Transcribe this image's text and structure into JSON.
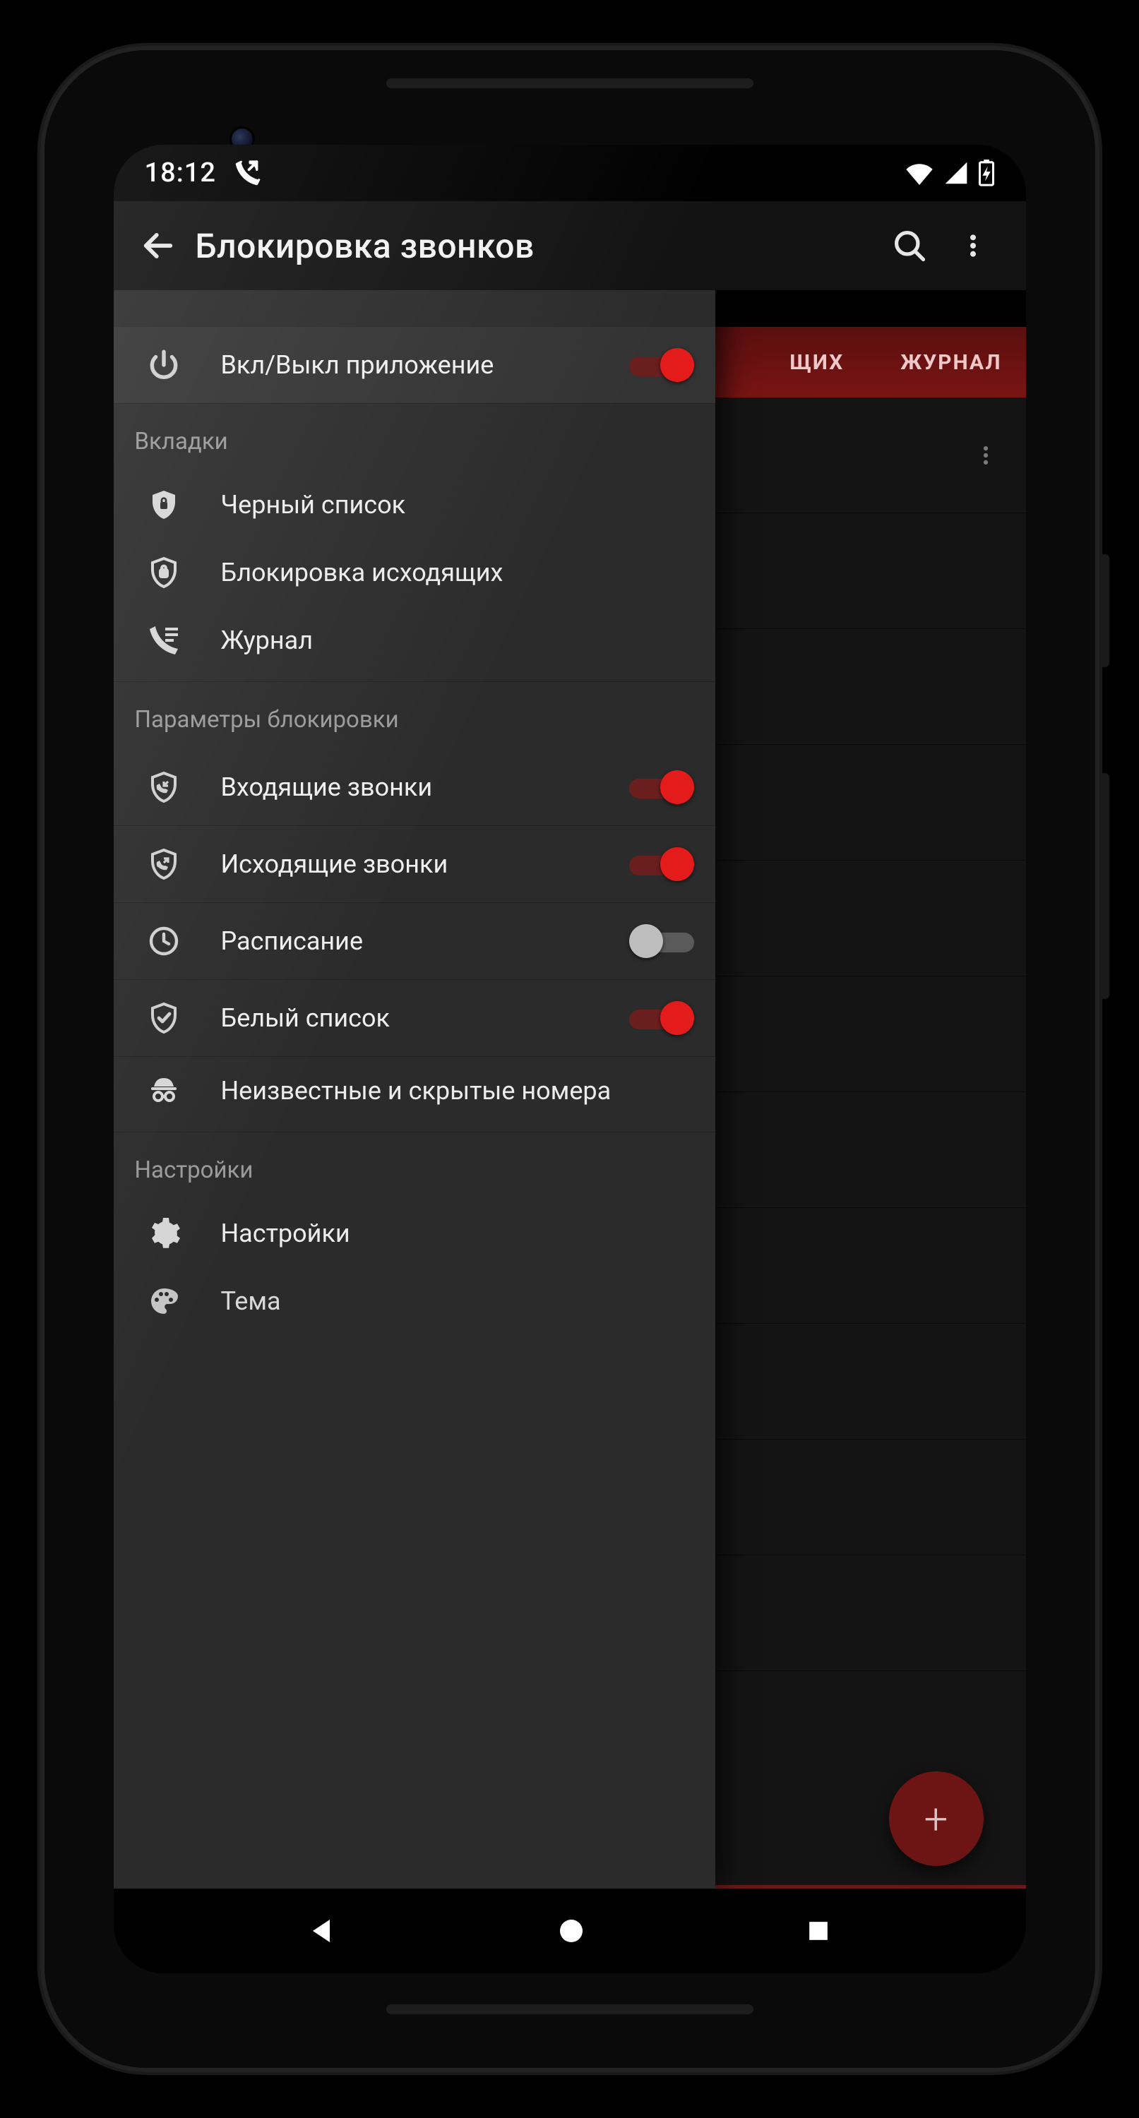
{
  "status": {
    "time": "18:12"
  },
  "appbar": {
    "title": "Блокировка звонков"
  },
  "tabs": {
    "t1_suffix": "ЩИХ",
    "t2": "ЖУРНАЛ"
  },
  "drawer": {
    "app_toggle_label": "Вкл/Выкл приложение",
    "section_tabs": "Вкладки",
    "tabs_items": {
      "blacklist": "Черный список",
      "outgoing_block": "Блокировка исходящих",
      "journal": "Журнал"
    },
    "section_params": "Параметры блокировки",
    "params": {
      "incoming": "Входящие звонки",
      "outgoing": "Исходящие звонки",
      "schedule": "Расписание",
      "whitelist": "Белый список",
      "unknown": "Неизвестные и скрытые номера"
    },
    "section_settings": "Настройки",
    "settings": {
      "settings": "Настройки",
      "theme": "Тема"
    }
  },
  "colors": {
    "accent": "#e31b1b",
    "fab": "#6d1414"
  }
}
